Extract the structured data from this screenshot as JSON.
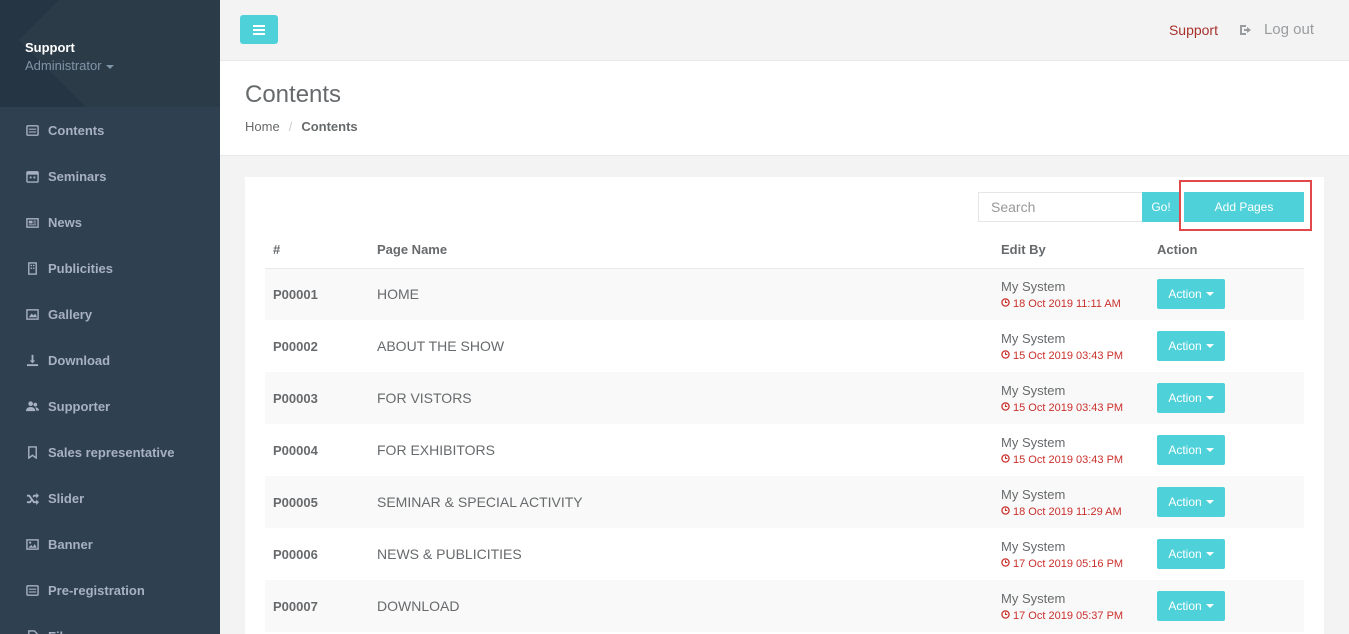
{
  "profile": {
    "name": "Support",
    "role": "Administrator"
  },
  "sidebar": {
    "items": [
      {
        "label": "Contents",
        "icon": "list-icon"
      },
      {
        "label": "Seminars",
        "icon": "calendar-icon"
      },
      {
        "label": "News",
        "icon": "newspaper-icon"
      },
      {
        "label": "Publicities",
        "icon": "building-icon"
      },
      {
        "label": "Gallery",
        "icon": "image-icon"
      },
      {
        "label": "Download",
        "icon": "download-icon"
      },
      {
        "label": "Supporter",
        "icon": "users-icon"
      },
      {
        "label": "Sales representative",
        "icon": "bookmark-icon"
      },
      {
        "label": "Slider",
        "icon": "shuffle-icon"
      },
      {
        "label": "Banner",
        "icon": "picture-icon"
      },
      {
        "label": "Pre-registration",
        "icon": "list-alt-icon"
      },
      {
        "label": "Files",
        "icon": "file-icon"
      }
    ]
  },
  "topbar": {
    "support_label": "Support",
    "logout_label": "Log out"
  },
  "heading": {
    "title": "Contents",
    "breadcrumb_home": "Home",
    "breadcrumb_current": "Contents"
  },
  "toolbar": {
    "search_placeholder": "Search",
    "go_label": "Go!",
    "add_label": "Add Pages"
  },
  "table": {
    "headers": {
      "id": "#",
      "page_name": "Page Name",
      "edit_by": "Edit By",
      "action": "Action"
    },
    "rows": [
      {
        "id": "P00001",
        "name": "HOME",
        "editor": "My System",
        "time": "18 Oct 2019 11:11 AM",
        "action": "Action"
      },
      {
        "id": "P00002",
        "name": "ABOUT THE SHOW",
        "editor": "My System",
        "time": "15 Oct 2019 03:43 PM",
        "action": "Action"
      },
      {
        "id": "P00003",
        "name": "FOR VISTORS",
        "editor": "My System",
        "time": "15 Oct 2019 03:43 PM",
        "action": "Action"
      },
      {
        "id": "P00004",
        "name": "FOR EXHIBITORS",
        "editor": "My System",
        "time": "15 Oct 2019 03:43 PM",
        "action": "Action"
      },
      {
        "id": "P00005",
        "name": "SEMINAR & SPECIAL ACTIVITY",
        "editor": "My System",
        "time": "18 Oct 2019 11:29 AM",
        "action": "Action"
      },
      {
        "id": "P00006",
        "name": "NEWS & PUBLICITIES",
        "editor": "My System",
        "time": "17 Oct 2019 05:16 PM",
        "action": "Action"
      },
      {
        "id": "P00007",
        "name": "DOWNLOAD",
        "editor": "My System",
        "time": "17 Oct 2019 05:37 PM",
        "action": "Action"
      }
    ]
  },
  "colors": {
    "accent": "#4fd1d9",
    "sidebar": "#2f4050",
    "danger": "#c9302c",
    "highlight": "#e0484a"
  }
}
